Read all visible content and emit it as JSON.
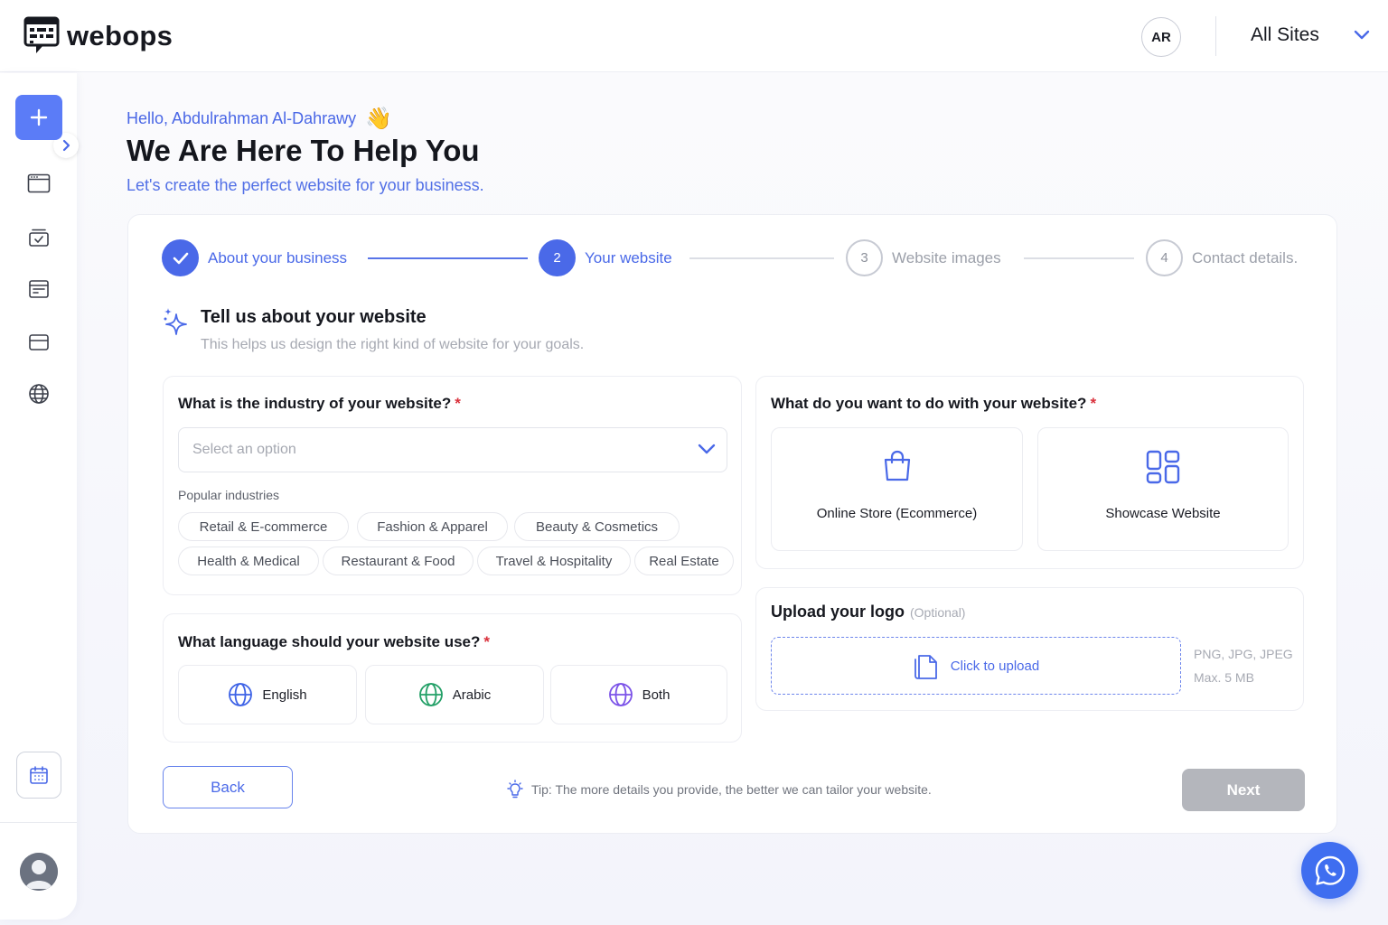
{
  "brand": {
    "name": "webops"
  },
  "header": {
    "user_initials": "AR",
    "site_selector": "All Sites"
  },
  "greeting": {
    "hello": "Hello, Abdulrahman Al-Dahrawy",
    "wave": "👋",
    "title": "We Are Here To Help You",
    "subtitle": "Let's create the perfect website for your business."
  },
  "stepper": [
    {
      "number": "1",
      "label": "About your business",
      "state": "done"
    },
    {
      "number": "2",
      "label": "Your website",
      "state": "active"
    },
    {
      "number": "3",
      "label": "Website images",
      "state": "todo"
    },
    {
      "number": "4",
      "label": "Contact details.",
      "state": "todo"
    }
  ],
  "section": {
    "title": "Tell us about your website",
    "subtitle": "This helps us design the right kind of website for your goals."
  },
  "industry": {
    "question": "What is the industry of your website?",
    "required": "*",
    "placeholder": "Select an option",
    "popular_label": "Popular industries",
    "chips": [
      "Retail & E-commerce",
      "Fashion & Apparel",
      "Beauty & Cosmetics",
      "Health & Medical",
      "Restaurant & Food",
      "Travel & Hospitality",
      "Real Estate"
    ]
  },
  "language": {
    "question": "What language should your website use?",
    "required": "*",
    "options": [
      "English",
      "Arabic",
      "Both"
    ]
  },
  "goal": {
    "question": "What do you want to do with your website?",
    "required": "*",
    "options": [
      "Online Store (Ecommerce)",
      "Showcase Website"
    ]
  },
  "upload": {
    "title": "Upload your logo",
    "optional": "(Optional)",
    "cta": "Click to upload",
    "formats": "PNG, JPG, JPEG",
    "max_size": "Max. 5 MB"
  },
  "footer": {
    "back": "Back",
    "tip": "Tip: The more details you provide, the better we can tailor your website.",
    "next": "Next"
  },
  "colors": {
    "primary": "#4a69e8",
    "disabled": "#b4b6bc",
    "required": "#d9303b",
    "globe_english": "#3e63e6",
    "globe_arabic": "#23a067",
    "globe_both": "#7b52e8"
  }
}
